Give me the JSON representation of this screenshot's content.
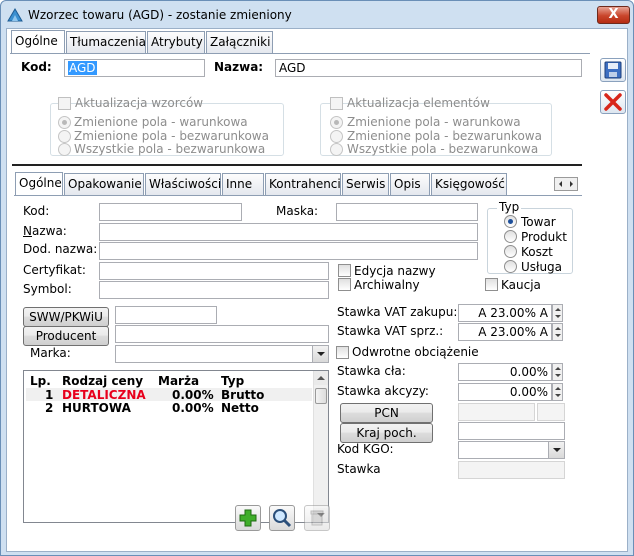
{
  "window": {
    "title": "Wzorzec towaru (AGD) - zostanie zmieniony",
    "close_label": "X"
  },
  "top_tabs": [
    {
      "label": "Ogólne",
      "active": true
    },
    {
      "label": "Tłumaczenia",
      "active": false
    },
    {
      "label": "Atrybuty",
      "active": false
    },
    {
      "label": "Załączniki",
      "active": false
    }
  ],
  "header": {
    "kod_label": "Kod:",
    "kod_value": "AGD",
    "nazwa_label": "Nazwa:",
    "nazwa_value": "AGD"
  },
  "update_templates": {
    "title": "Aktualizacja wzorców",
    "options": [
      "Zmienione pola - warunkowa",
      "Zmienione pola - bezwarunkowa",
      "Wszystkie pola - bezwarunkowa"
    ],
    "selected": 0
  },
  "update_elements": {
    "title": "Aktualizacja elementów",
    "options": [
      "Zmienione pola - warunkowa",
      "Zmienione pola - bezwarunkowa",
      "Wszystkie pola - bezwarunkowa"
    ],
    "selected": 0
  },
  "inner_tabs": [
    {
      "label": "Ogólne",
      "active": true
    },
    {
      "label": "Opakowanie",
      "active": false
    },
    {
      "label": "Właściwości",
      "active": false
    },
    {
      "label": "Inne",
      "active": false
    },
    {
      "label": "Kontrahenci",
      "active": false
    },
    {
      "label": "Serwis",
      "active": false
    },
    {
      "label": "Opis",
      "active": false
    },
    {
      "label": "Księgowość",
      "active": false
    }
  ],
  "general": {
    "kod_label": "Kod:",
    "maska_label": "Maska:",
    "nazwa_label": "Nazwa:",
    "dod_nazwa_label": "Dod. nazwa:",
    "certyfikat_label": "Certyfikat:",
    "symbol_label": "Symbol:",
    "edycja_nazwy_label": "Edycja nazwy",
    "archiwalny_label": "Archiwalny",
    "kaucja_label": "Kaucja",
    "sww_button": "SWW/PKWiU",
    "producent_button": "Producent",
    "marka_label": "Marka:"
  },
  "typ": {
    "title": "Typ",
    "options": [
      "Towar",
      "Produkt",
      "Koszt",
      "Usługa"
    ],
    "selected": 0
  },
  "vat": {
    "zakup_label": "Stawka VAT zakupu:",
    "zakup_value": "A 23.00% A",
    "sprz_label": "Stawka VAT sprz.:",
    "sprz_value": "A 23.00% A",
    "odwrotne_label": "Odwrotne obciążenie",
    "cla_label": "Stawka cła:",
    "cla_value": "0.00%",
    "akcyzy_label": "Stawka akcyzy:",
    "akcyzy_value": "0.00%",
    "pcn_button": "PCN",
    "kraj_button": "Kraj poch.",
    "kgo_label": "Kod KGO:",
    "stawka_label": "Stawka"
  },
  "price_table": {
    "headers": [
      "Lp.",
      "Rodzaj ceny",
      "Marża",
      "Typ"
    ],
    "rows": [
      {
        "lp": "1",
        "name": "DETALICZNA",
        "marza": "0.00%",
        "typ": "Brutto",
        "color": "#e8001c"
      },
      {
        "lp": "2",
        "name": "HURTOWA",
        "marza": "0.00%",
        "typ": "Netto",
        "color": "#000000"
      }
    ]
  },
  "colors": {
    "selection": "#3399ff",
    "frame": "#cfe0f1"
  }
}
